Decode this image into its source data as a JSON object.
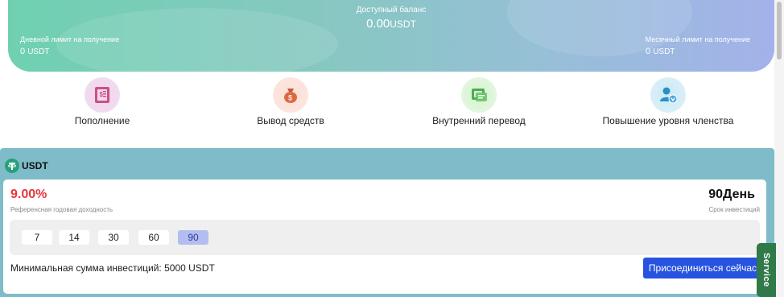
{
  "balance": {
    "available_label": "Доступный баланс",
    "available_amount": "0.00",
    "available_unit": "USDT",
    "daily_limit_label": "Дневной лимит на получение",
    "daily_limit_amount": "0",
    "daily_limit_unit": "USDT",
    "monthly_limit_label": "Месячный лимит на получение",
    "monthly_limit_amount": "0",
    "monthly_limit_unit": "USDT"
  },
  "actions": [
    {
      "label": "Пополнение",
      "icon": "deposit-receipt-icon"
    },
    {
      "label": "Вывод средств",
      "icon": "money-bag-icon"
    },
    {
      "label": "Внутренний перевод",
      "icon": "transfer-icon"
    },
    {
      "label": "Повышение уровня членства",
      "icon": "member-upgrade-icon"
    }
  ],
  "product": {
    "name": "USDT",
    "icon": "tether-icon",
    "rate": "9.00%",
    "rate_label": "Референсная годовая доходность",
    "term": "90День",
    "term_label": "Срок инвестиций",
    "days": [
      "7",
      "14",
      "30",
      "60",
      "90"
    ],
    "selected_day": "90",
    "min_label": "Минимальная сумма инвестиций:  5000 USDT",
    "join_label": "Присоединиться сейчас"
  },
  "service_label": "Service",
  "colors": {
    "accent": "#2753e0",
    "rate_red": "#e5373d",
    "section_bg": "#7ebcc9",
    "service_green": "#2f7a48"
  }
}
